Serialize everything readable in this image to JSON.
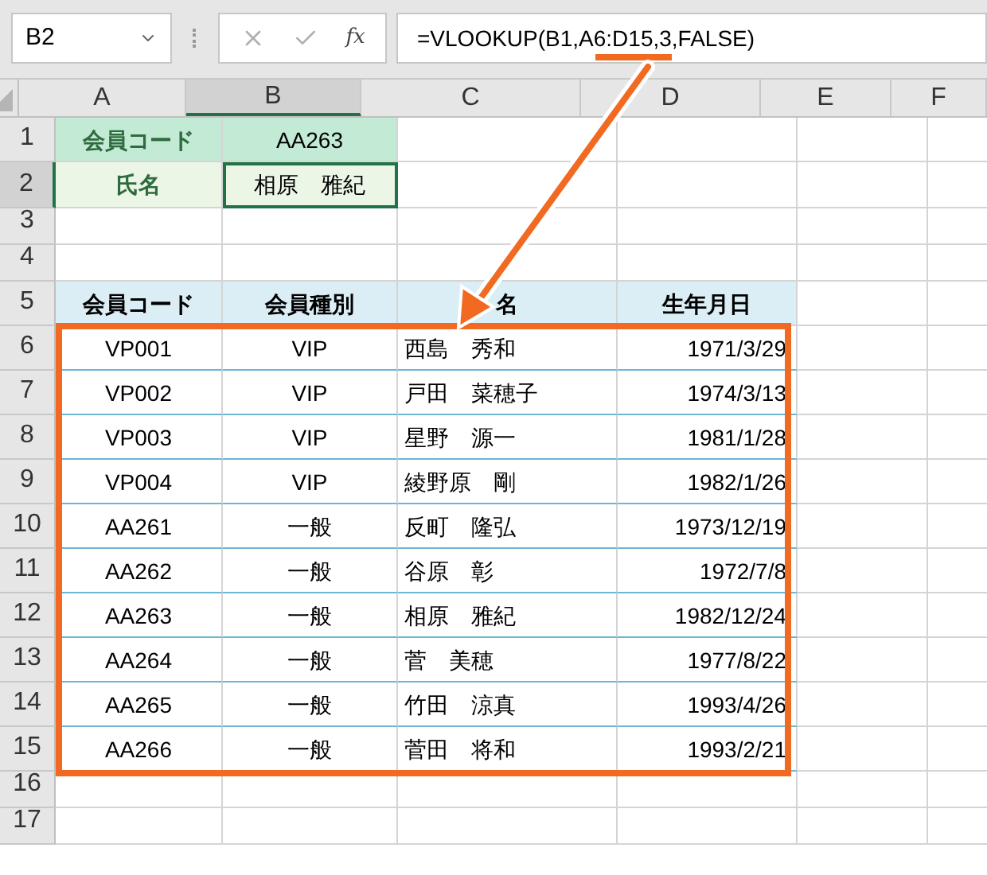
{
  "name_box": {
    "value": "B2"
  },
  "formula_bar": {
    "function_label": "fx",
    "formula": "=VLOOKUP(B1,A6:D15,3,FALSE)"
  },
  "columns": [
    {
      "label": "A",
      "selected": false
    },
    {
      "label": "B",
      "selected": true
    },
    {
      "label": "C",
      "selected": false
    },
    {
      "label": "D",
      "selected": false
    },
    {
      "label": "E",
      "selected": false
    },
    {
      "label": "F",
      "selected": false
    }
  ],
  "rows": [
    {
      "number": "1",
      "selected": false,
      "kind": "input",
      "cells": [
        "会員コード",
        "AA263"
      ]
    },
    {
      "number": "2",
      "selected": true,
      "kind": "output",
      "cells": [
        "氏名",
        "相原　雅紀"
      ]
    },
    {
      "number": "3",
      "selected": false,
      "kind": "blank"
    },
    {
      "number": "4",
      "selected": false,
      "kind": "blank"
    },
    {
      "number": "5",
      "selected": false,
      "kind": "header",
      "cells": [
        "会員コード",
        "会員種別",
        "名",
        "生年月日"
      ]
    },
    {
      "number": "6",
      "selected": false,
      "kind": "data",
      "cells": [
        "VP001",
        "VIP",
        "西島　秀和",
        "1971/3/29"
      ]
    },
    {
      "number": "7",
      "selected": false,
      "kind": "data",
      "cells": [
        "VP002",
        "VIP",
        "戸田　菜穂子",
        "1974/3/13"
      ]
    },
    {
      "number": "8",
      "selected": false,
      "kind": "data",
      "cells": [
        "VP003",
        "VIP",
        "星野　源一",
        "1981/1/28"
      ]
    },
    {
      "number": "9",
      "selected": false,
      "kind": "data",
      "cells": [
        "VP004",
        "VIP",
        "綾野原　剛",
        "1982/1/26"
      ]
    },
    {
      "number": "10",
      "selected": false,
      "kind": "data",
      "cells": [
        "AA261",
        "一般",
        "反町　隆弘",
        "1973/12/19"
      ]
    },
    {
      "number": "11",
      "selected": false,
      "kind": "data",
      "cells": [
        "AA262",
        "一般",
        "谷原　彰",
        "1972/7/8"
      ]
    },
    {
      "number": "12",
      "selected": false,
      "kind": "data",
      "cells": [
        "AA263",
        "一般",
        "相原　雅紀",
        "1982/12/24"
      ]
    },
    {
      "number": "13",
      "selected": false,
      "kind": "data",
      "cells": [
        "AA264",
        "一般",
        "菅　美穂",
        "1977/8/22"
      ]
    },
    {
      "number": "14",
      "selected": false,
      "kind": "data",
      "cells": [
        "AA265",
        "一般",
        "竹田　涼真",
        "1993/4/26"
      ]
    },
    {
      "number": "15",
      "selected": false,
      "kind": "data",
      "cells": [
        "AA266",
        "一般",
        "菅田　将和",
        "1993/2/21"
      ]
    },
    {
      "number": "16",
      "selected": false,
      "kind": "blank"
    },
    {
      "number": "17",
      "selected": false,
      "kind": "blank"
    }
  ]
}
